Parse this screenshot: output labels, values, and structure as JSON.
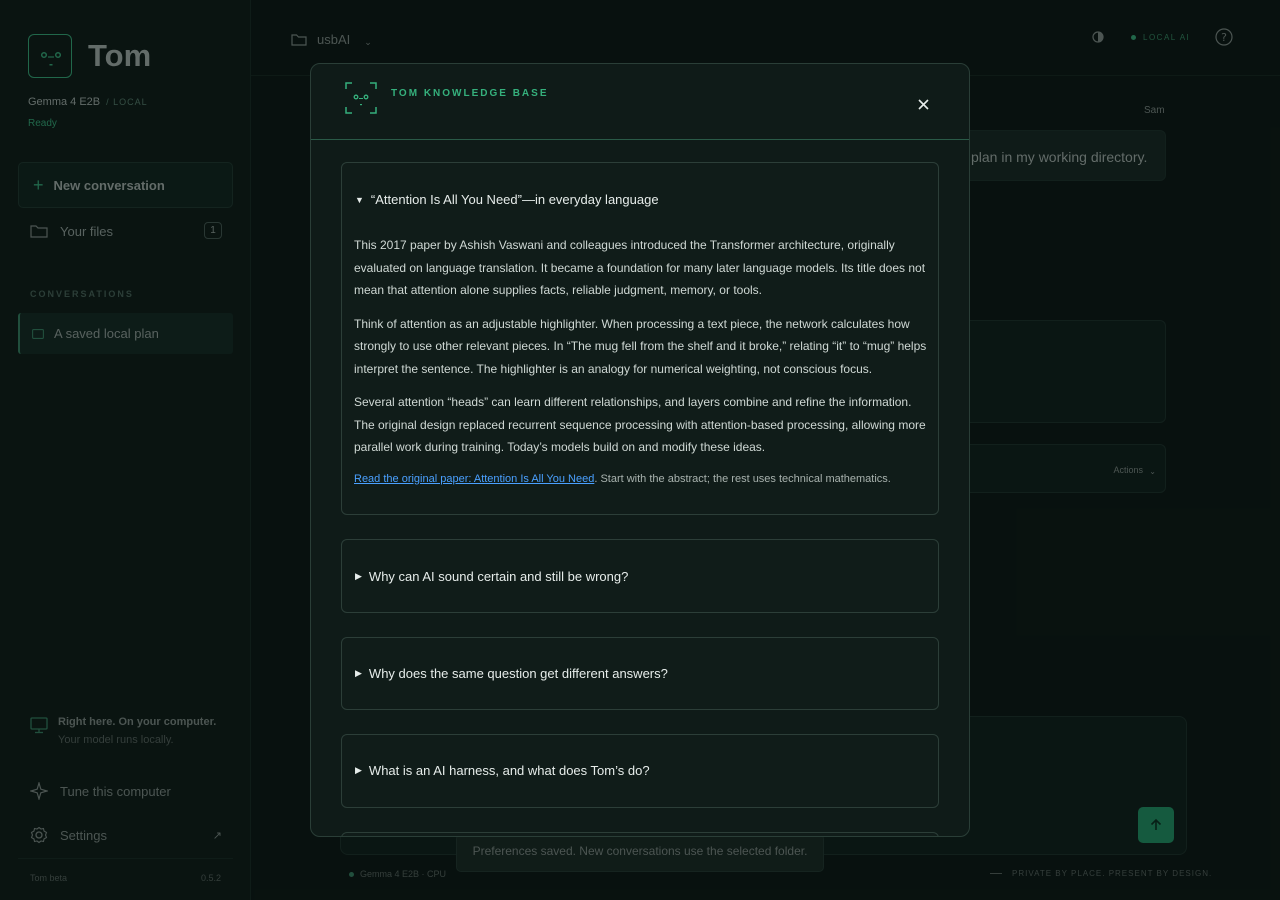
{
  "app": {
    "name": "Tom",
    "model": "Gemma 4 E2B",
    "model_tag": "/ LOCAL",
    "status": "Ready"
  },
  "sidebar": {
    "new_conversation": "New conversation",
    "your_files": "Your files",
    "files_count": "1",
    "conversations_heading": "CONVERSATIONS",
    "conversations": [
      {
        "label": "A saved local plan"
      }
    ],
    "local_note_title": "Right here. On your computer.",
    "local_note_sub": "Your model runs locally.",
    "tune": "Tune this computer",
    "settings": "Settings",
    "settings_ext": "↗",
    "footer_left": "Tom beta",
    "footer_right": "0.5.2"
  },
  "topbar": {
    "folder": "usbAI",
    "local_ai": "LOCAL AI"
  },
  "chat": {
    "sender": "Sam",
    "user_message_visible": "plan in my working directory.",
    "actions_label": "Actions"
  },
  "toast": "Preferences saved. New conversations use the selected folder.",
  "statusbar": {
    "left": "Gemma 4 E2B · CPU",
    "right": "PRIVATE BY PLACE. PRESENT BY DESIGN."
  },
  "modal": {
    "title": "TOM KNOWLEDGE BASE",
    "faqs": [
      {
        "question": "“Attention Is All You Need”—in everyday language",
        "expanded": true,
        "paragraphs": [
          "This 2017 paper by Ashish Vaswani and colleagues introduced the Transformer architecture, originally evaluated on language translation. It became a foundation for many later language models. Its title does not mean that attention alone supplies facts, reliable judgment, memory, or tools.",
          "Think of attention as an adjustable highlighter. When processing a text piece, the network calculates how strongly to use other relevant pieces. In “The mug fell from the shelf and it broke,” relating “it” to “mug” helps interpret the sentence. The highlighter is an analogy for numerical weighting, not conscious focus.",
          "Several attention “heads” can learn different relationships, and layers combine and refine the information. The original design replaced recurrent sequence processing with attention-based processing, allowing more parallel work during training. Today’s models build on and modify these ideas."
        ],
        "link_text": "Read the original paper: Attention Is All You Need",
        "link_suffix": ". Start with the abstract; the rest uses technical mathematics."
      },
      {
        "question": "Why can AI sound certain and still be wrong?",
        "expanded": false
      },
      {
        "question": "Why does the same question get different answers?",
        "expanded": false
      },
      {
        "question": "What is an AI harness, and what does Tom’s do?",
        "expanded": false
      }
    ]
  },
  "colors": {
    "accent": "#35b07c",
    "link": "#4aa0ff",
    "send_button": "#1e7a55"
  }
}
